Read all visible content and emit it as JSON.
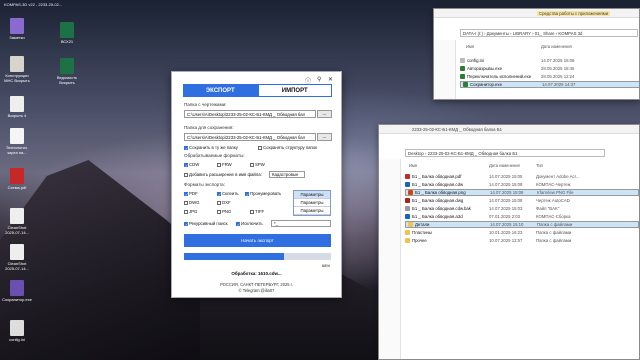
{
  "taskbar_top": {
    "title": "KOMPAS-3D v22 - 2233-25-02..."
  },
  "desktop_icons": [
    {
      "label": "Заметки"
    },
    {
      "label": "ВСХ21"
    },
    {
      "label": "Конструкции МНС Вскрыть"
    },
    {
      "label": "Ведомость Вскрыть"
    },
    {
      "label": "Вскрыть 4"
    },
    {
      "label": "Технологич. карта на..."
    },
    {
      "label": "Схема.pdf"
    },
    {
      "label": "CleanShot 2025-07-14..."
    },
    {
      "label": "CleanShot 2025-07-14..."
    },
    {
      "label": "Сохранитор.exe"
    },
    {
      "label": "config.ini"
    }
  ],
  "app": {
    "tab_export": "ЭКСПОРТ",
    "tab_import": "ИМПОРТ",
    "drawings_label": "Папка с чертежами:",
    "drawings_path": "C:\\Users\\A\\Desktop\\2233-25-02-КС-Б1-КМД _ Обводная бал",
    "browse": "...",
    "save_label": "Папка для сохранения:",
    "save_path": "C:\\Users\\A\\Desktop\\2233-25-02-КС-Б1-КМД _ Обводная бал",
    "same_folder": "Сохранить в ту же папку",
    "keep_structure": "Сохранять структуру папок",
    "process_formats_label": "Обрабатываемые форматы:",
    "cdw": "CDW",
    "frw": "FRW",
    "spw": "SPW",
    "add_ext": "Добавить расширение в имя файла:",
    "add_ext_value": "Кадастровые",
    "export_formats_label": "Форматы экспорта:",
    "pdf": "PDF",
    "merge": "Склеить",
    "number": "Пронумеровать",
    "params": "Параметры",
    "dwg": "DWG",
    "dxf": "DXF",
    "jpg": "JPG",
    "tiff": "TIFF",
    "png": "PNG",
    "recursive": "Рекурсивный поиск",
    "exclude": "Исключить",
    "exclude_value": "*_",
    "dropdown": [
      "Параметры",
      "Параметры",
      "Параметры"
    ],
    "start": "Начать экспорт",
    "progress": 0.68,
    "progress_text": "68%",
    "processing": "Обработка: 1610.cdw...",
    "footer_line1": "РОССИЯ, САНКТ-ПЕТЕРБУРГ, 2025 г.",
    "footer_line2": "© Telegram:@ilia07"
  },
  "explorer_top": {
    "ribbon": "Средства работы с приложениями",
    "address": "DATA-I (I:) › Документы › LIBRARY › 01_ Share › KOMPAS 3d",
    "col_name": "Имя",
    "col_date": "Дата изменения",
    "files": [
      {
        "name": "config.ini",
        "date": "14.07.2025 15:08"
      },
      {
        "name": "Авторазрывы.exe",
        "date": "28.05.2025 18:45"
      },
      {
        "name": "Переключатель исполнений.exe",
        "date": "28.05.2025 12:24"
      },
      {
        "name": "Сохранитор.exe",
        "date": "14.07.2025 14:37"
      }
    ]
  },
  "explorer_bottom": {
    "titlebar": "2233-25-02-КС-Б1-КМД _ Обводная балка Б1",
    "address": "Desktop › 2233-25-02-КС-Б1-КМД _ Обводная балка Б1",
    "col_name": "Имя",
    "col_date": "Дата изменения",
    "col_type": "Тип",
    "files": [
      {
        "name": "Б1 _ Балка обводная.pdf",
        "date": "14.07.2025 15:05",
        "type": "Документ Adobe Acr..."
      },
      {
        "name": "Б1 _ Балка обводная.cdw",
        "date": "14.07.2025 15:08",
        "type": "КОМПАС-Чертеж"
      },
      {
        "name": "Б1 _ Балка обводная.png",
        "date": "14.07.2025 15:08",
        "type": "IrfanView PNG File"
      },
      {
        "name": "Б1 _ Балка обводная.dwg",
        "date": "14.07.2025 15:08",
        "type": "Чертеж AutoCAD"
      },
      {
        "name": "Б1 _ Балка обводная.cdw.bak",
        "date": "14.07.2025 15:03",
        "type": "Файл \"BAK\""
      },
      {
        "name": "Б1 _ Балка обводная.a3d",
        "date": "07.01.2025 2:03",
        "type": "КОМПАС-Сборка"
      },
      {
        "name": "Детали",
        "date": "14.07.2025 15:10",
        "type": "Папка с файлами"
      },
      {
        "name": "Пластины",
        "date": "10.01.2025 16:23",
        "type": "Папка с файлами"
      },
      {
        "name": "Прочее",
        "date": "10.07.2025 12:57",
        "type": "Папка с файлами"
      }
    ]
  }
}
